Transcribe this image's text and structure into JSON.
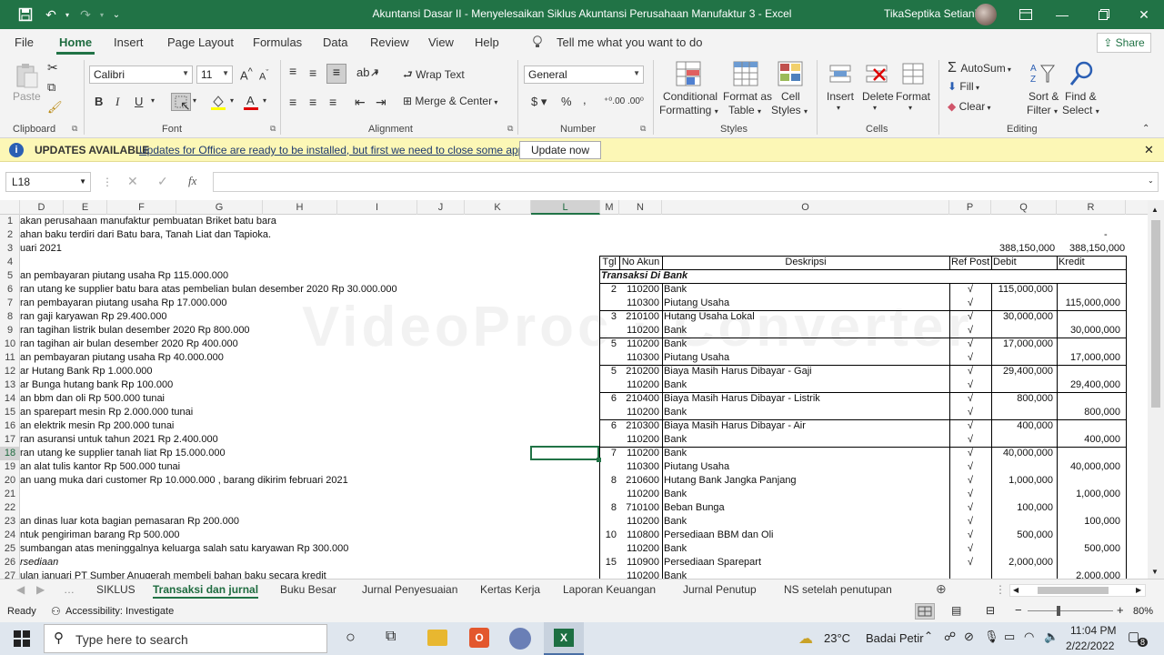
{
  "window": {
    "title": "Akuntansi Dasar II - Menyelesaikan Siklus Akuntansi Perusahaan Manufaktur 3  -  Excel",
    "user": "TikaSeptika Setiani"
  },
  "menu": {
    "tabs": [
      "File",
      "Home",
      "Insert",
      "Page Layout",
      "Formulas",
      "Data",
      "Review",
      "View",
      "Help"
    ],
    "active": "Home",
    "tell_me": "Tell me what you want to do",
    "share": "Share"
  },
  "ribbon": {
    "clipboard": {
      "paste": "Paste",
      "label": "Clipboard"
    },
    "font": {
      "name": "Calibri",
      "size": "11",
      "label": "Font"
    },
    "alignment": {
      "wrap_text": "Wrap Text",
      "merge_center": "Merge & Center",
      "label": "Alignment"
    },
    "number": {
      "format": "General",
      "label": "Number"
    },
    "styles": {
      "conditional": [
        "Conditional",
        "Formatting"
      ],
      "format_table": [
        "Format as",
        "Table"
      ],
      "cell_styles": [
        "Cell",
        "Styles"
      ],
      "label": "Styles"
    },
    "cells": {
      "insert": "Insert",
      "delete": "Delete",
      "format": "Format",
      "label": "Cells"
    },
    "editing": {
      "autosum": "AutoSum",
      "fill": "Fill",
      "clear": "Clear",
      "sort": [
        "Sort &",
        "Filter"
      ],
      "find": [
        "Find &",
        "Select"
      ],
      "label": "Editing"
    }
  },
  "updates": {
    "title": "UPDATES AVAILABLE",
    "message": "Updates for Office are ready to be installed, but first we need to close some apps.",
    "button": "Update now"
  },
  "formula_bar": {
    "name_box": "L18",
    "fx": "fx",
    "content": ""
  },
  "columns": [
    "D",
    "E",
    "F",
    "G",
    "H",
    "I",
    "J",
    "K",
    "L",
    "M",
    "N",
    "O",
    "P",
    "Q",
    "R"
  ],
  "rows": [
    "1",
    "2",
    "3",
    "4",
    "5",
    "6",
    "7",
    "8",
    "9",
    "10",
    "11",
    "12",
    "13",
    "14",
    "15",
    "16",
    "17",
    "18",
    "19",
    "20",
    "21",
    "22",
    "23",
    "24",
    "25",
    "26",
    "27"
  ],
  "left_notes": [
    "akan perusahaan manufaktur pembuatan Briket batu bara",
    "ahan baku terdiri dari Batu bara, Tanah Liat dan Tapioka.",
    "uari 2021",
    "",
    "an pembayaran piutang usaha Rp 115.000.000",
    "ran utang ke supplier batu bara atas pembelian bulan desember 2020 Rp 30.000.000",
    "ran pembayaran piutang usaha Rp 17.000.000",
    "ran gaji karyawan Rp 29.400.000",
    "ran tagihan listrik bulan desember 2020 Rp 800.000",
    "ran tagihan air bulan desember 2020 Rp 400.000",
    "an pembayaran piutang usaha Rp 40.000.000",
    "ar Hutang Bank Rp 1.000.000",
    "ar Bunga hutang bank Rp 100.000",
    "an bbm dan oli Rp 500.000 tunai",
    "an sparepart mesin Rp 2.000.000 tunai",
    "an elektrik mesin Rp 200.000 tunai",
    "ran asuransi untuk tahun 2021 Rp 2.400.000",
    "ran utang ke supplier tanah liat Rp 15.000.000",
    "an alat tulis kantor Rp 500.000 tunai",
    "an uang muka dari customer Rp 10.000.000 , barang dikirim februari 2021",
    "",
    "",
    "an dinas luar kota bagian pemasaran Rp 200.000",
    "ntuk pengiriman barang Rp 500.000",
    " sumbangan atas meninggalnya keluarga salah satu karyawan Rp 300.000",
    "rsediaan",
    "ulan januari PT Sumber Anugerah membeli bahan baku secara kredit"
  ],
  "journal": {
    "dash": "-",
    "total_debit": "388,150,000",
    "total_kredit": "388,150,000",
    "headers": [
      "Tgl",
      "No Akun",
      "Deskripsi",
      "Ref Post",
      "Debit",
      "Kredit"
    ],
    "section": "Transaksi Di Bank",
    "entries": [
      {
        "tgl": "2",
        "akun": "110200",
        "desc": "Bank",
        "ref": "√",
        "debit": "115,000,000",
        "kredit": ""
      },
      {
        "tgl": "",
        "akun": "110300",
        "desc": "Piutang Usaha",
        "ref": "√",
        "debit": "",
        "kredit": "115,000,000"
      },
      {
        "tgl": "3",
        "akun": "210100",
        "desc": "Hutang Usaha Lokal",
        "ref": "√",
        "debit": "30,000,000",
        "kredit": ""
      },
      {
        "tgl": "",
        "akun": "110200",
        "desc": "Bank",
        "ref": "√",
        "debit": "",
        "kredit": "30,000,000"
      },
      {
        "tgl": "5",
        "akun": "110200",
        "desc": "Bank",
        "ref": "√",
        "debit": "17,000,000",
        "kredit": ""
      },
      {
        "tgl": "",
        "akun": "110300",
        "desc": "Piutang Usaha",
        "ref": "√",
        "debit": "",
        "kredit": "17,000,000"
      },
      {
        "tgl": "5",
        "akun": "210200",
        "desc": "Biaya Masih Harus Dibayar - Gaji",
        "ref": "√",
        "debit": "29,400,000",
        "kredit": ""
      },
      {
        "tgl": "",
        "akun": "110200",
        "desc": "Bank",
        "ref": "√",
        "debit": "",
        "kredit": "29,400,000"
      },
      {
        "tgl": "6",
        "akun": "210400",
        "desc": "Biaya Masih Harus Dibayar - Listrik",
        "ref": "√",
        "debit": "800,000",
        "kredit": ""
      },
      {
        "tgl": "",
        "akun": "110200",
        "desc": "Bank",
        "ref": "√",
        "debit": "",
        "kredit": "800,000"
      },
      {
        "tgl": "6",
        "akun": "210300",
        "desc": "Biaya Masih Harus Dibayar - Air",
        "ref": "√",
        "debit": "400,000",
        "kredit": ""
      },
      {
        "tgl": "",
        "akun": "110200",
        "desc": "Bank",
        "ref": "√",
        "debit": "",
        "kredit": "400,000"
      },
      {
        "tgl": "7",
        "akun": "110200",
        "desc": "Bank",
        "ref": "√",
        "debit": "40,000,000",
        "kredit": ""
      },
      {
        "tgl": "",
        "akun": "110300",
        "desc": "Piutang Usaha",
        "ref": "√",
        "debit": "",
        "kredit": "40,000,000"
      },
      {
        "tgl": "8",
        "akun": "210600",
        "desc": "Hutang Bank Jangka Panjang",
        "ref": "√",
        "debit": "1,000,000",
        "kredit": ""
      },
      {
        "tgl": "",
        "akun": "110200",
        "desc": "Bank",
        "ref": "√",
        "debit": "",
        "kredit": "1,000,000"
      },
      {
        "tgl": "8",
        "akun": "710100",
        "desc": "Beban Bunga",
        "ref": "√",
        "debit": "100,000",
        "kredit": ""
      },
      {
        "tgl": "",
        "akun": "110200",
        "desc": "Bank",
        "ref": "√",
        "debit": "",
        "kredit": "100,000"
      },
      {
        "tgl": "10",
        "akun": "110800",
        "desc": "Persediaan BBM dan Oli",
        "ref": "√",
        "debit": "500,000",
        "kredit": ""
      },
      {
        "tgl": "",
        "akun": "110200",
        "desc": "Bank",
        "ref": "√",
        "debit": "",
        "kredit": "500,000"
      },
      {
        "tgl": "15",
        "akun": "110900",
        "desc": "Persediaan Sparepart",
        "ref": "√",
        "debit": "2,000,000",
        "kredit": ""
      },
      {
        "tgl": "",
        "akun": "110200",
        "desc": "Bank",
        "ref": "",
        "debit": "",
        "kredit": "2,000,000"
      }
    ]
  },
  "sheet_tabs": [
    "SIKLUS",
    "Transaksi dan jurnal",
    "Buku Besar",
    "Jurnal Penyesuaian",
    "Kertas Kerja",
    "Laporan Keuangan",
    "Jurnal Penutup",
    "NS setelah penutupan"
  ],
  "active_sheet": "Transaksi dan jurnal",
  "status": {
    "ready": "Ready",
    "accessibility": "Accessibility: Investigate",
    "zoom": "80%"
  },
  "taskbar": {
    "search_placeholder": "Type here to search",
    "weather_temp": "23°C",
    "weather_desc": "Badai Petir",
    "time": "11:04 PM",
    "date": "2/22/2022",
    "notifications": "8"
  }
}
